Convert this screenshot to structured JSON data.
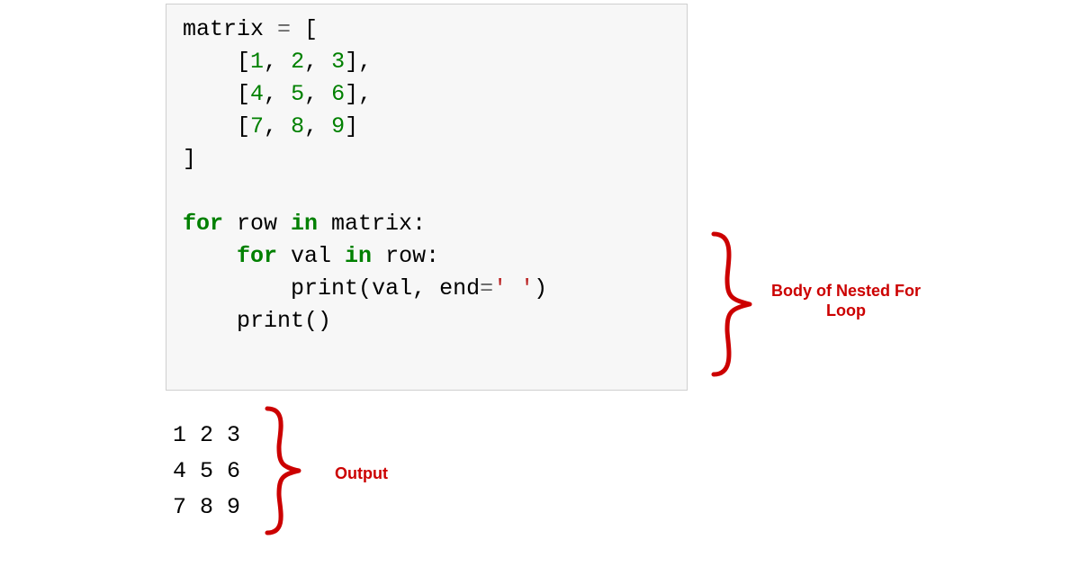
{
  "code": {
    "line1_var": "matrix ",
    "line1_eq": "= ",
    "line1_br": "[",
    "line2_pad": "    ",
    "line2_open": "[",
    "line2_comma": ", ",
    "line2_close": "],",
    "line3_close": "],",
    "line4_close": "]",
    "line5": "]",
    "for_kw": "for",
    "in_kw": "in",
    "outer_loop_var": " row ",
    "outer_loop_iter": " matrix:",
    "inner_pad": "    ",
    "inner_loop_var": " val ",
    "inner_loop_iter": " row:",
    "print_pad8": "        ",
    "print_fn": "print",
    "print_open": "(",
    "print_arg": "val, end",
    "print_eq": "=",
    "print_str": "' '",
    "print_close": ")",
    "print2_pad": "    ",
    "print2_fn": "print",
    "print2_parens": "()",
    "n1": "1",
    "n2": "2",
    "n3": "3",
    "n4": "4",
    "n5": "5",
    "n6": "6",
    "n7": "7",
    "n8": "8",
    "n9": "9"
  },
  "output": {
    "row1": "1 2 3",
    "row2": "4 5 6",
    "row3": "7 8 9"
  },
  "labels": {
    "body": "Body of Nested For Loop",
    "output": "Output"
  },
  "colors": {
    "brace": "#cc0000",
    "keyword": "#008000",
    "string": "#BA2121",
    "codebg": "#f7f7f7"
  }
}
